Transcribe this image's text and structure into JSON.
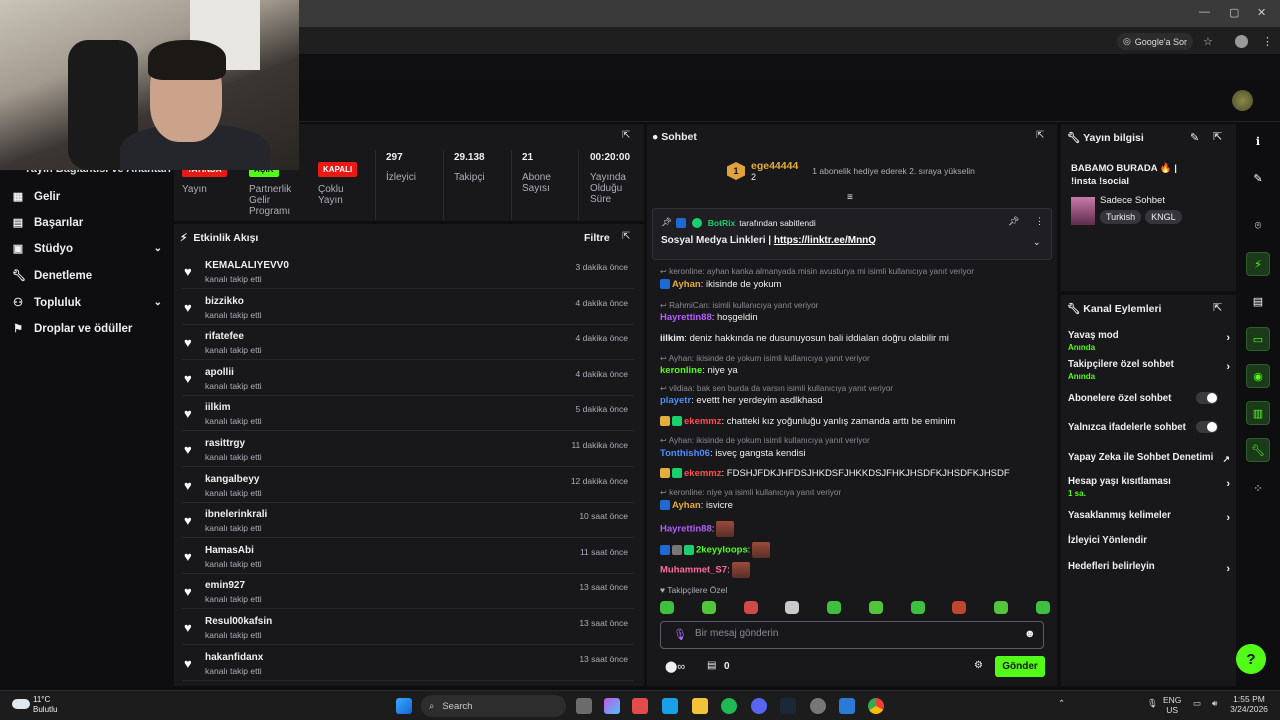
{
  "browser": {
    "google_sor": "Google'a Sor"
  },
  "sidebar": {
    "partial_item": "Yayın Bağlantısı ve Anahtarı",
    "items": [
      {
        "label": "Gelir",
        "icon": "chart-icon"
      },
      {
        "label": "Başarılar",
        "icon": "grid-icon"
      },
      {
        "label": "Stüdyo",
        "icon": "video-icon",
        "expand": true
      },
      {
        "label": "Denetleme",
        "icon": "wrench-icon"
      },
      {
        "label": "Topluluk",
        "icon": "users-icon",
        "expand": true
      },
      {
        "label": "Droplar ve ödüller",
        "icon": "gift-icon"
      }
    ]
  },
  "stats": [
    {
      "badge": "YAYINDA",
      "label": "Yayın"
    },
    {
      "badge": "AÇIK",
      "label": "Partnerlik Gelir Programı"
    },
    {
      "badge": "KAPALI",
      "label": "Çoklu Yayın"
    },
    {
      "value": "297",
      "label": "İzleyici"
    },
    {
      "value": "29.138",
      "label": "Takipçi"
    },
    {
      "value": "21",
      "label": "Abone Sayısı"
    },
    {
      "value": "00:20:00",
      "label": "Yayında Olduğu Süre"
    }
  ],
  "activity": {
    "title": "Etkinlik Akışı",
    "filter": "Filtre",
    "events": [
      {
        "name": "KEMALALIYEVV0",
        "action": "kanalı takip etti",
        "time": "3 dakika önce"
      },
      {
        "name": "bizzikko",
        "action": "kanalı takip etti",
        "time": "4 dakika önce"
      },
      {
        "name": "rifatefee",
        "action": "kanalı takip etti",
        "time": "4 dakika önce"
      },
      {
        "name": "apollii",
        "action": "kanalı takip etti",
        "time": "4 dakika önce"
      },
      {
        "name": "iilkim",
        "action": "kanalı takip etti",
        "time": "5 dakika önce"
      },
      {
        "name": "rasittrgy",
        "action": "kanalı takip etti",
        "time": "11 dakika önce"
      },
      {
        "name": "kangalbeyy",
        "action": "kanalı takip etti",
        "time": "12 dakika önce"
      },
      {
        "name": "ibnelerinkrali",
        "action": "kanalı takip etti",
        "time": "10 saat önce"
      },
      {
        "name": "HamasAbi",
        "action": "kanalı takip etti",
        "time": "11 saat önce"
      },
      {
        "name": "emin927",
        "action": "kanalı takip etti",
        "time": "13 saat önce"
      },
      {
        "name": "Resul00kafsin",
        "action": "kanalı takip etti",
        "time": "13 saat önce"
      },
      {
        "name": "hakanfidanx",
        "action": "kanalı takip etti",
        "time": "13 saat önce"
      }
    ]
  },
  "chat": {
    "title": "Sohbet",
    "top_gifter": {
      "rank": "1",
      "name": "ege44444",
      "count": "2",
      "note": "1 abonelik hediye ederek 2. sıraya yükselin"
    },
    "pinned": {
      "by_user": "BotRix",
      "by_text": "tarafından sabitlendi",
      "text": "Sosyal Medya Linkleri | ",
      "link": "https://linktr.ee/MnnQ"
    },
    "messages": [
      {
        "reply": "keronline: ayhan kanka almanyada misin avusturya mi isimli kullanıcıya yanıt veriyor",
        "user": "Ayhan",
        "color": "#e5ad3b",
        "text": ": ikisinde de yokum"
      },
      {
        "reply": "RahmiCan: isimli kullanıcıya yanıt veriyor",
        "user": "Hayrettin88",
        "color": "#b45cff",
        "text": ": hoşgeldin"
      },
      {
        "user": "iilkim",
        "color": "#efeff1",
        "text": ": deniz hakkında ne dusunuyosun bali iddiaları doğru olabilir mi"
      },
      {
        "reply": "Ayhan: ikisinde de yokum isimli kullanıcıya yanıt veriyor",
        "user": "keronline",
        "color": "#53fc18",
        "text": ": niye ya"
      },
      {
        "reply": "vildiaa: bak sen burda da varsın isimli kullanıcıya yanıt veriyor",
        "user": "playetr",
        "color": "#4f8cff",
        "text": ": evettt her yerdeyim asdlkhasd"
      },
      {
        "user": "ekemmz",
        "color": "#ff4d4d",
        "text": ": chatteki kız yoğunluğu yanlış zamanda arttı be eminim"
      },
      {
        "reply": "Ayhan: ikisinde de yokum isimli kullanıcıya yanıt veriyor",
        "user": "Tonthish06",
        "color": "#4f8cff",
        "text": ": isveç gangsta kendisi"
      },
      {
        "user": "ekemmz",
        "color": "#ff4d4d",
        "text": ": FDSHJFDKJHFDSJHKDSFJHKKDSJFHKJHSDFKJHSDFKJHSDF"
      },
      {
        "reply": "keronline: niye ya isimli kullanıcıya yanıt veriyor",
        "user": "Ayhan",
        "color": "#e5ad3b",
        "text": ": isvicre"
      },
      {
        "user": "Hayrettin88",
        "color": "#b45cff",
        "text": ":"
      },
      {
        "user": "2keyyloops",
        "color": "#53fc18",
        "text": ":"
      },
      {
        "user": "Muhammet_S7",
        "color": "#ff6b9a",
        "text": ":"
      }
    ],
    "followers_only": "Takipçilere Özel",
    "input_placeholder": "Bir mesaj gönderin",
    "points": "0",
    "send": "Gönder"
  },
  "stream_info": {
    "title": "Yayın bilgisi",
    "stream_title": "BABAMO BURADA 🔥 | !insta !social",
    "category": "Sadece Sohbet",
    "tags": [
      "Turkish",
      "KNGL"
    ]
  },
  "channel_actions": {
    "title": "Kanal Eylemleri",
    "items": [
      {
        "label": "Yavaş mod",
        "sub": "Anında",
        "type": "arrow"
      },
      {
        "label": "Takipçilere özel sohbet",
        "sub": "Anında",
        "type": "arrow"
      },
      {
        "label": "Abonelere özel sohbet",
        "type": "toggle"
      },
      {
        "label": "Yalnızca ifadelerle sohbet",
        "type": "toggle"
      },
      {
        "label": "Yapay Zeka ile Sohbet Denetimi",
        "type": "external"
      },
      {
        "label": "Hesap yaşı kısıtlaması",
        "sub": "1 sa.",
        "type": "arrow"
      },
      {
        "label": "Yasaklanmış kelimeler",
        "type": "arrow"
      },
      {
        "label": "İzleyici Yönlendir",
        "type": "none"
      },
      {
        "label": "Hedefleri belirleyin",
        "type": "arrow"
      }
    ]
  },
  "taskbar": {
    "weather_temp": "11°C",
    "weather_desc": "Bulutlu",
    "search": "Search",
    "lang1": "ENG",
    "lang2": "US",
    "time": "1:55 PM",
    "date": "3/24/2026"
  },
  "colors": {
    "accent": "#53fc18",
    "panel": "#18181b",
    "bg": "#0e0e10"
  }
}
